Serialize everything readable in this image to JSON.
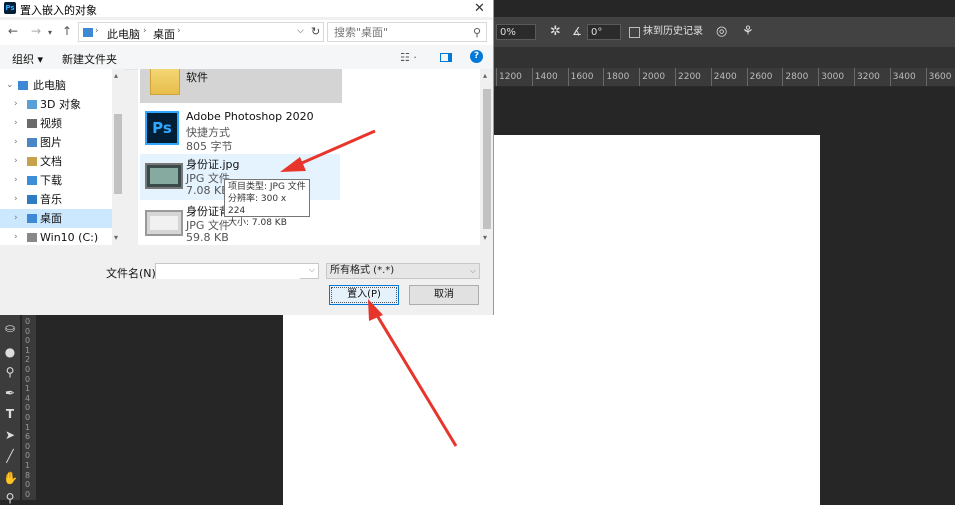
{
  "dialog": {
    "title": "置入嵌入的对象",
    "close_symbol": "✕",
    "breadcrumb": [
      "此电脑",
      "桌面"
    ],
    "search_placeholder": "搜索\"桌面\"",
    "commands": {
      "organize": "组织 ▾",
      "new_folder": "新建文件夹"
    },
    "nav_items": [
      {
        "label": "此电脑",
        "icon": "pc-icon"
      },
      {
        "label": "3D 对象",
        "icon": "3d-objects-icon"
      },
      {
        "label": "视频",
        "icon": "video-icon"
      },
      {
        "label": "图片",
        "icon": "pictures-icon"
      },
      {
        "label": "文档",
        "icon": "documents-icon"
      },
      {
        "label": "下载",
        "icon": "downloads-icon"
      },
      {
        "label": "音乐",
        "icon": "music-icon"
      },
      {
        "label": "桌面",
        "icon": "desktop-icon",
        "selected": true
      },
      {
        "label": "Win10 (C:)",
        "icon": "drive-icon"
      }
    ],
    "files": [
      {
        "name": "软件",
        "kind": "folder"
      },
      {
        "name": "Adobe Photoshop 2020",
        "type": "快捷方式",
        "size": "805 字节"
      },
      {
        "name": "身份证.jpg",
        "type": "JPG 文件",
        "size": "7.08 KB"
      },
      {
        "name": "身份证背",
        "type": "JPG 文件",
        "size": "59.8 KB"
      }
    ],
    "tooltip": [
      "项目类型: JPG 文件",
      "分辨率: 300 x 224",
      "大小: 7.08 KB"
    ],
    "filename_label": "文件名(N):",
    "filename_value": "",
    "filter_value": "所有格式 (*.*)",
    "place_button": "置入(P)",
    "cancel_button": "取消"
  },
  "photoshop": {
    "opacity_value": "0%",
    "angle_value": "0°",
    "history_label": "抹到历史记录",
    "ruler_ticks": [
      "1200",
      "1400",
      "1600",
      "1800",
      "2000",
      "2200",
      "2400",
      "2600",
      "2800",
      "3000",
      "3200",
      "3400",
      "3600"
    ],
    "vruler_digits": [
      "0",
      "0",
      "0",
      "1",
      "2",
      "0",
      "0",
      "1",
      "4",
      "0",
      "0",
      "1",
      "6",
      "0",
      "0",
      "1",
      "8",
      "0",
      "0"
    ]
  },
  "colors": {
    "accent": "#0078d7",
    "arrow": "#e8352b",
    "ps_bg": "#262626",
    "selected": "#cce8ff"
  }
}
